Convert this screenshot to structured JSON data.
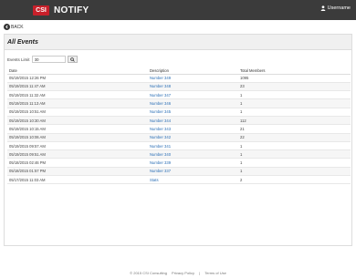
{
  "header": {
    "logo_mark": "CSI",
    "app_name": "NOTIFY",
    "user_label": "Username",
    "user_icon": "user-icon"
  },
  "nav": {
    "back_label": "BACK"
  },
  "panel": {
    "title": "All Events",
    "filter_label": "Events Limit",
    "filter_value": "30",
    "columns": [
      "Date",
      "Description",
      "Total Members"
    ],
    "rows": [
      [
        "05/19/2015 12:26 PM",
        "Number 349",
        "1095"
      ],
      [
        "05/19/2015 11:47 AM",
        "Number 348",
        "23"
      ],
      [
        "05/19/2015 11:32 AM",
        "Number 347",
        "1"
      ],
      [
        "05/19/2015 11:13 AM",
        "Number 346",
        "1"
      ],
      [
        "05/19/2015 10:51 AM",
        "Number 345",
        "1"
      ],
      [
        "05/19/2015 10:30 AM",
        "Number 344",
        "112"
      ],
      [
        "05/19/2015 10:15 AM",
        "Number 343",
        "21"
      ],
      [
        "05/19/2015 10:06 AM",
        "Number 342",
        "22"
      ],
      [
        "05/19/2015 09:57 AM",
        "Number 341",
        "1"
      ],
      [
        "05/19/2015 09:51 AM",
        "Number 340",
        "1"
      ],
      [
        "05/18/2015 02:46 PM",
        "Number 339",
        "1"
      ],
      [
        "05/18/2015 01:57 PM",
        "Number 337",
        "1"
      ],
      [
        "05/17/2015 11:03 AM",
        "Stats",
        "2"
      ]
    ]
  },
  "footer": {
    "copyright": "© 2015 CSI Consulting",
    "privacy": "Privacy Policy",
    "separator": "|",
    "terms": "Terms of Use"
  }
}
